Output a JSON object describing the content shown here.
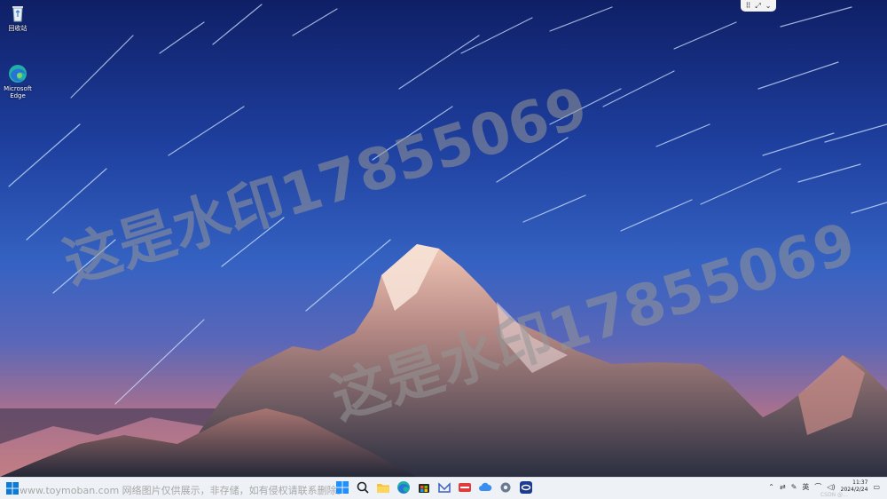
{
  "desktop": {
    "icons": [
      {
        "label": "回收站",
        "icon": "recycle-bin-icon"
      },
      {
        "label": "Microsoft\nEdge",
        "icon": "edge-icon"
      }
    ]
  },
  "snap_widget": {
    "icon": "snap-layout-icon",
    "chevron": "chevron-down-icon"
  },
  "watermarks": [
    "这是水印17855069",
    "这是水印17855069"
  ],
  "taskbar": {
    "source_text": "www.toymoban.com 网络图片仅供展示，非存储，如有侵权请联系删除。",
    "pinned": [
      "windows-start-icon",
      "search-icon",
      "file-explorer-icon",
      "edge-icon",
      "store-icon",
      "mail-icon",
      "red-app-icon",
      "cloud-icon",
      "settings-icon",
      "tencent-meeting-icon"
    ],
    "tray": {
      "ime": "英",
      "clock_time": "11:37",
      "clock_date": "2024/2/24",
      "csdn": "CSDN @…"
    }
  },
  "colors": {
    "taskbar_bg": "#eef1f6",
    "accent": "#0078d4"
  }
}
